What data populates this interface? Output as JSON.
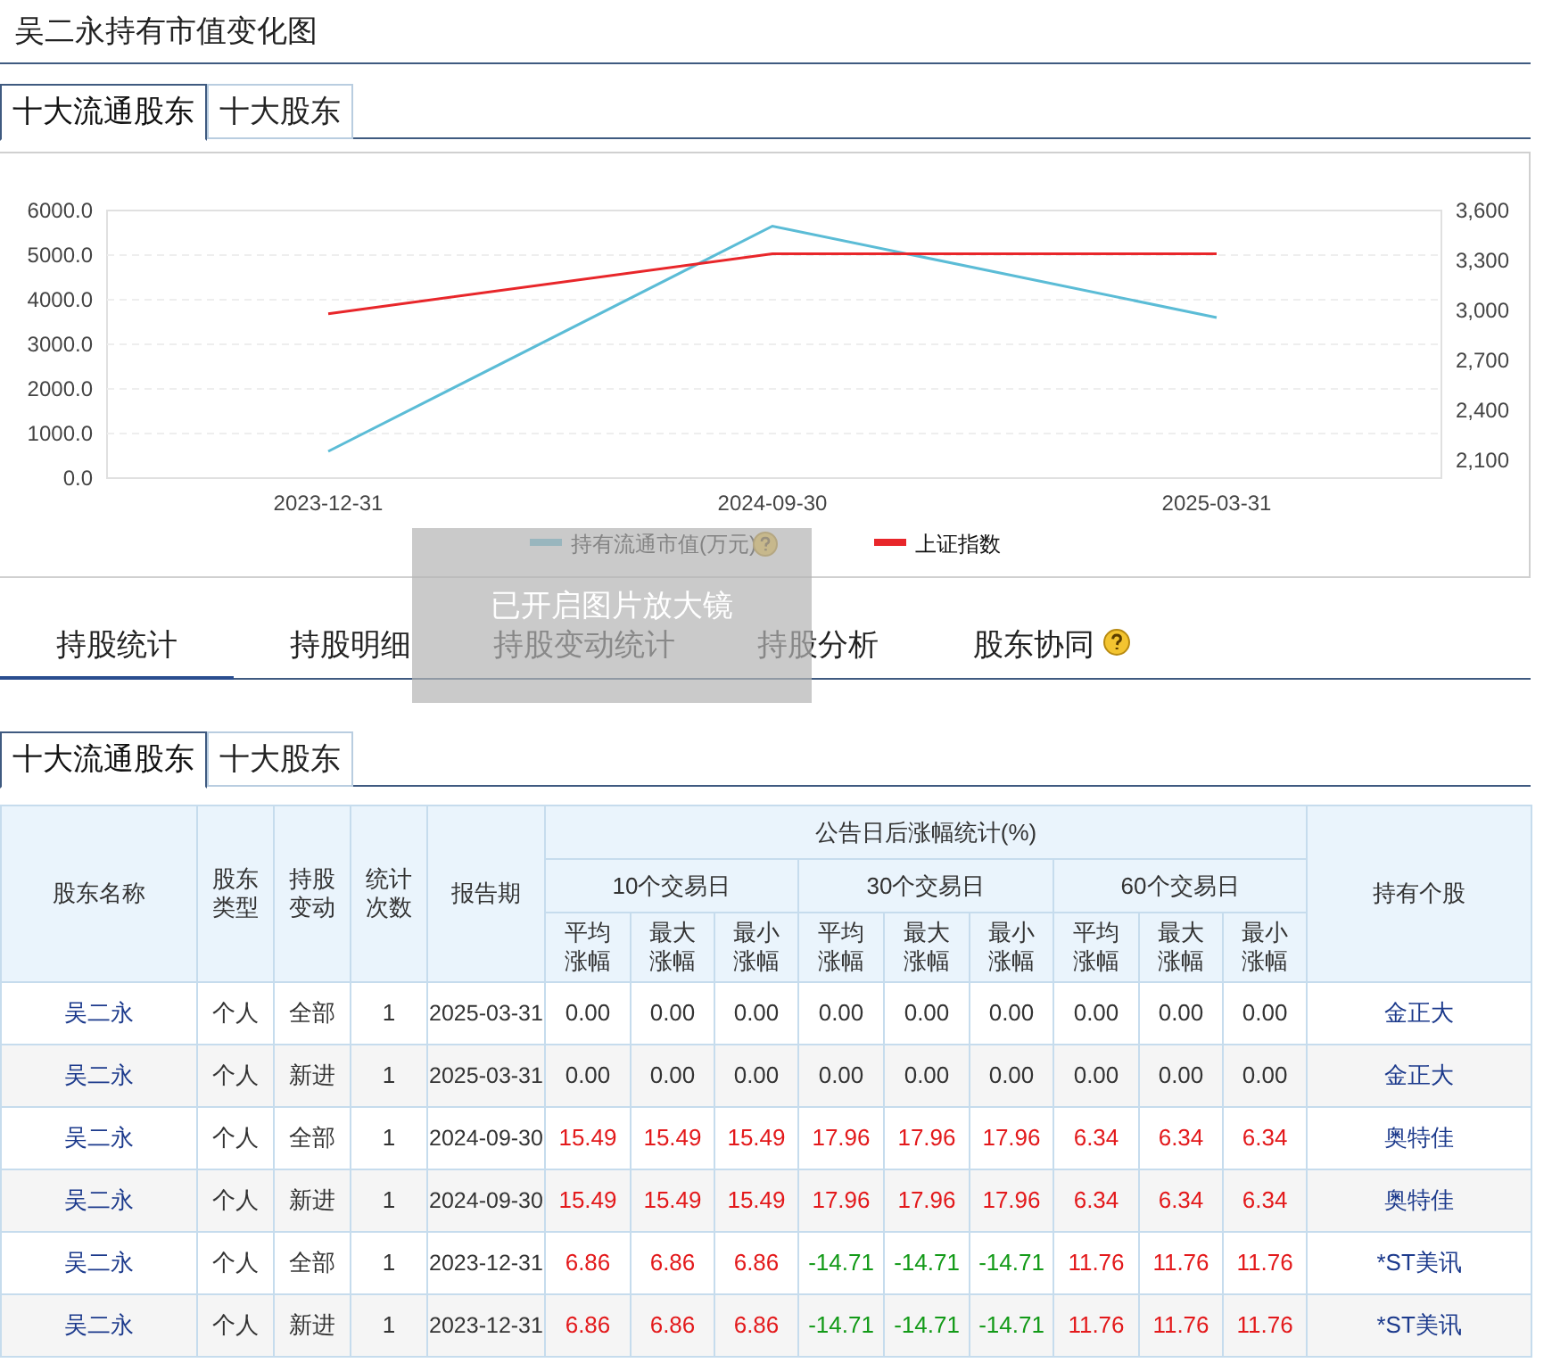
{
  "title": "吴二永持有市值变化图",
  "chart_tabs": [
    {
      "label": "十大流通股东",
      "selected": true
    },
    {
      "label": "十大股东",
      "selected": false
    }
  ],
  "chart": {
    "chart_data": {
      "type": "line",
      "categories": [
        "2023-12-31",
        "2024-09-30",
        "2025-03-31"
      ],
      "series": [
        {
          "name": "持有流通市值(万元)",
          "color": "#5bbcd6",
          "values": [
            600,
            5650,
            3600
          ]
        },
        {
          "name": "上证指数",
          "color": "#e8262a",
          "values": [
            2980,
            3340,
            3340
          ],
          "axis": "y2"
        }
      ],
      "ylim": [
        0,
        6000
      ],
      "yticks": [
        {
          "value": 0,
          "label": "0.0"
        },
        {
          "value": 1000,
          "label": "1000.0"
        },
        {
          "value": 2000,
          "label": "2000.0"
        },
        {
          "value": 3000,
          "label": "3000.0"
        },
        {
          "value": 4000,
          "label": "4000.0"
        },
        {
          "value": 5000,
          "label": "5000.0"
        },
        {
          "value": 6000,
          "label": "6000.0"
        }
      ],
      "grid": true,
      "legend": "bottom",
      "y2lim": [
        1993,
        3600
      ],
      "y2ticks": [
        {
          "value": 2100,
          "label": "2,100"
        },
        {
          "value": 2400,
          "label": "2,400"
        },
        {
          "value": 2700,
          "label": "2,700"
        },
        {
          "value": 3000,
          "label": "3,000"
        },
        {
          "value": 3300,
          "label": "3,300"
        },
        {
          "value": 3600,
          "label": "3,600"
        }
      ]
    }
  },
  "toast": "已开启图片放大镜",
  "main_tabs": [
    {
      "label": "持股统计",
      "selected": true,
      "help": false
    },
    {
      "label": "持股明细",
      "selected": false,
      "help": false
    },
    {
      "label": "持股变动统计",
      "selected": false,
      "help": false
    },
    {
      "label": "持股分析",
      "selected": false,
      "help": false
    },
    {
      "label": "股东协同",
      "selected": false,
      "help": true
    }
  ],
  "table_tabs": [
    {
      "label": "十大流通股东",
      "selected": true
    },
    {
      "label": "十大股东",
      "selected": false
    }
  ],
  "table": {
    "columns": [
      "股东名称",
      "股东类型",
      "持股变动",
      "统计次数",
      "报告期"
    ],
    "group": "公告日后涨幅统计(%)",
    "periods": [
      "10个交易日",
      "30个交易日",
      "60个交易日"
    ],
    "sub_columns": [
      "平均涨幅",
      "最大涨幅",
      "最小涨幅",
      "平均涨幅",
      "最大涨幅",
      "最小涨幅",
      "平均涨幅",
      "最大涨幅",
      "最小涨幅"
    ],
    "last_column": "持有个股",
    "rows": [
      {
        "name": "吴二永",
        "type": "个人",
        "change": "全部",
        "count": "1",
        "date": "2025-03-31",
        "values": [
          "0.00",
          "0.00",
          "0.00",
          "0.00",
          "0.00",
          "0.00",
          "0.00",
          "0.00",
          "0.00"
        ],
        "stock": "金正大"
      },
      {
        "name": "吴二永",
        "type": "个人",
        "change": "新进",
        "count": "1",
        "date": "2025-03-31",
        "values": [
          "0.00",
          "0.00",
          "0.00",
          "0.00",
          "0.00",
          "0.00",
          "0.00",
          "0.00",
          "0.00"
        ],
        "stock": "金正大"
      },
      {
        "name": "吴二永",
        "type": "个人",
        "change": "全部",
        "count": "1",
        "date": "2024-09-30",
        "values": [
          "15.49",
          "15.49",
          "15.49",
          "17.96",
          "17.96",
          "17.96",
          "6.34",
          "6.34",
          "6.34"
        ],
        "stock": "奥特佳"
      },
      {
        "name": "吴二永",
        "type": "个人",
        "change": "新进",
        "count": "1",
        "date": "2024-09-30",
        "values": [
          "15.49",
          "15.49",
          "15.49",
          "17.96",
          "17.96",
          "17.96",
          "6.34",
          "6.34",
          "6.34"
        ],
        "stock": "奥特佳"
      },
      {
        "name": "吴二永",
        "type": "个人",
        "change": "全部",
        "count": "1",
        "date": "2023-12-31",
        "values": [
          "6.86",
          "6.86",
          "6.86",
          "-14.71",
          "-14.71",
          "-14.71",
          "11.76",
          "11.76",
          "11.76"
        ],
        "stock": "*ST美讯"
      },
      {
        "name": "吴二永",
        "type": "个人",
        "change": "新进",
        "count": "1",
        "date": "2023-12-31",
        "values": [
          "6.86",
          "6.86",
          "6.86",
          "-14.71",
          "-14.71",
          "-14.71",
          "11.76",
          "11.76",
          "11.76"
        ],
        "stock": "*ST美讯"
      }
    ]
  }
}
